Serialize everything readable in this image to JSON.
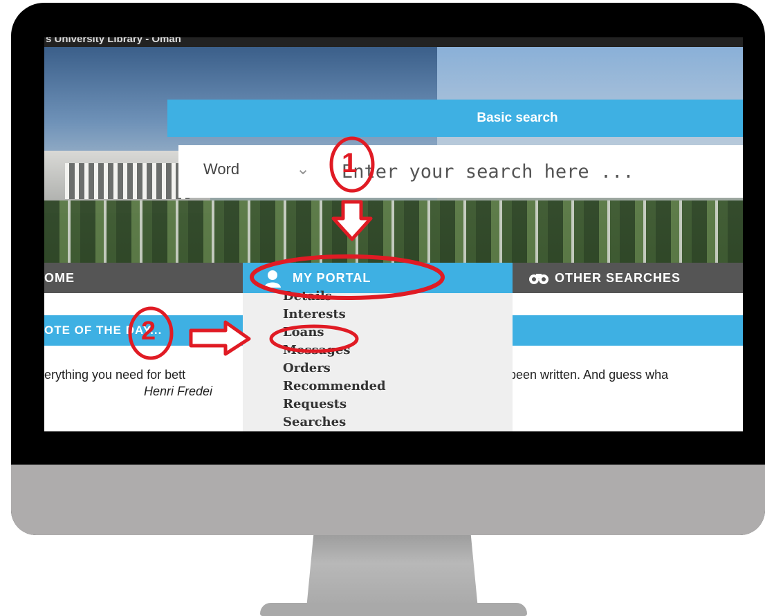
{
  "window": {
    "title": "s University Library - Oman"
  },
  "search": {
    "heading": "Basic search",
    "type_label": "Word",
    "chevron": "⌄",
    "placeholder": "Enter your search here ..."
  },
  "nav": {
    "home": "OME",
    "portal": "MY PORTAL",
    "other": "OTHER SEARCHES"
  },
  "portal_menu": {
    "items": [
      "Details",
      "Interests",
      "Loans",
      "Messages",
      "Orders",
      "Recommended",
      "Requests",
      "Searches"
    ]
  },
  "quote": {
    "heading": "OTE OF THE DAY...",
    "text_left": "erything you need for bett",
    "author": "Henri Fredei",
    "text_right": "been written. And guess wha"
  },
  "annotations": {
    "step1": "1",
    "step2": "2",
    "color": "#e01b24"
  },
  "colors": {
    "accent": "#3eb0e3",
    "nav": "#555555",
    "bezel": "#000000",
    "chin": "#aeacac"
  }
}
